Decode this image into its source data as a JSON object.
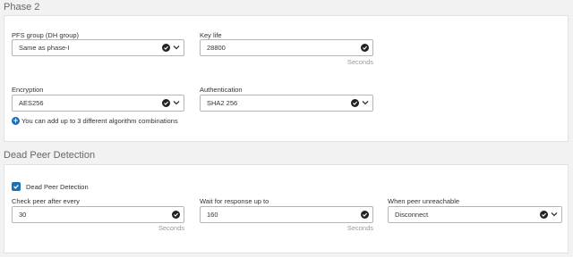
{
  "phase2": {
    "title": "Phase 2",
    "pfs": {
      "label": "PFS group (DH group)",
      "value": "Same as phase-I"
    },
    "key_life": {
      "label": "Key life",
      "value": "28800",
      "unit": "Seconds"
    },
    "encryption": {
      "label": "Encryption",
      "value": "AES256"
    },
    "authentication": {
      "label": "Authentication",
      "value": "SHA2 256"
    },
    "info": "You can add up to 3 different algorithm combinations"
  },
  "dpd": {
    "title": "Dead Peer Detection",
    "checkbox_label": "Dead Peer Detection",
    "checked": true,
    "check_peer": {
      "label": "Check peer after every",
      "value": "30",
      "unit": "Seconds"
    },
    "wait_response": {
      "label": "Wait for response up to",
      "value": "160",
      "unit": "Seconds"
    },
    "when_unreachable": {
      "label": "When peer unreachable",
      "value": "Disconnect"
    }
  },
  "icons": {
    "ok": "check-circle-icon",
    "dropdown": "chevron-down-icon",
    "info": "plus-circle-icon"
  },
  "colors": {
    "accent": "#1f6fb5",
    "panel_bg": "#ffffff",
    "page_bg": "#f2f2f2"
  }
}
